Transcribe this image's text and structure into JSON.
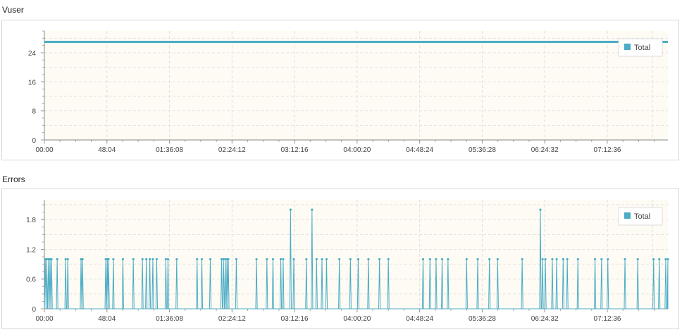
{
  "chart_data": [
    {
      "type": "line",
      "title": "Vuser",
      "xlabel": "",
      "ylabel": "",
      "x_tick_labels": [
        "00:00",
        "48:04",
        "01:36:08",
        "02:24:12",
        "03:12:16",
        "04:00:20",
        "04:48:24",
        "05:36:28",
        "06:24:32",
        "07:12:36"
      ],
      "y_ticks": [
        0,
        8,
        16,
        24
      ],
      "ylim": [
        0,
        30
      ],
      "xlim_seconds": [
        0,
        28750
      ],
      "grid": true,
      "legend": {
        "position": "top-right",
        "entries": [
          "Total"
        ]
      },
      "series": [
        {
          "name": "Total",
          "color": "#4bacc6",
          "x_seconds": [
            0,
            28750
          ],
          "values": [
            27,
            27
          ]
        }
      ]
    },
    {
      "type": "line",
      "title": "Errors",
      "xlabel": "",
      "ylabel": "",
      "x_tick_labels": [
        "00:00",
        "48:04",
        "01:36:08",
        "02:24:12",
        "03:12:16",
        "04:00:20",
        "04:48:24",
        "05:36:28",
        "06:24:32",
        "07:12:36"
      ],
      "y_ticks": [
        0,
        0.6,
        1.2,
        1.8
      ],
      "ylim": [
        0,
        2.2
      ],
      "xlim_seconds": [
        0,
        28750
      ],
      "grid": true,
      "legend": {
        "position": "top-right",
        "entries": [
          "Total"
        ]
      },
      "series": [
        {
          "name": "Total",
          "color": "#4bacc6",
          "spikes": [
            {
              "t": 40,
              "v": 1
            },
            {
              "t": 110,
              "v": 1
            },
            {
              "t": 190,
              "v": 1
            },
            {
              "t": 260,
              "v": 1
            },
            {
              "t": 330,
              "v": 1
            },
            {
              "t": 590,
              "v": 1
            },
            {
              "t": 980,
              "v": 1
            },
            {
              "t": 1080,
              "v": 1
            },
            {
              "t": 1690,
              "v": 1
            },
            {
              "t": 1760,
              "v": 1
            },
            {
              "t": 2830,
              "v": 1
            },
            {
              "t": 2900,
              "v": 1
            },
            {
              "t": 2960,
              "v": 1
            },
            {
              "t": 3180,
              "v": 1
            },
            {
              "t": 3620,
              "v": 1
            },
            {
              "t": 4100,
              "v": 1
            },
            {
              "t": 4520,
              "v": 1
            },
            {
              "t": 4700,
              "v": 1
            },
            {
              "t": 4860,
              "v": 1
            },
            {
              "t": 5000,
              "v": 1
            },
            {
              "t": 5180,
              "v": 1
            },
            {
              "t": 5600,
              "v": 1
            },
            {
              "t": 5700,
              "v": 1
            },
            {
              "t": 6100,
              "v": 1
            },
            {
              "t": 7040,
              "v": 1
            },
            {
              "t": 7260,
              "v": 1
            },
            {
              "t": 7650,
              "v": 1
            },
            {
              "t": 8170,
              "v": 1
            },
            {
              "t": 8260,
              "v": 1
            },
            {
              "t": 8340,
              "v": 1
            },
            {
              "t": 8420,
              "v": 1
            },
            {
              "t": 8480,
              "v": 1
            },
            {
              "t": 8850,
              "v": 1
            },
            {
              "t": 9780,
              "v": 1
            },
            {
              "t": 10260,
              "v": 1
            },
            {
              "t": 10540,
              "v": 1
            },
            {
              "t": 10900,
              "v": 1
            },
            {
              "t": 11010,
              "v": 1
            },
            {
              "t": 11350,
              "v": 2
            },
            {
              "t": 11500,
              "v": 1
            },
            {
              "t": 12080,
              "v": 1
            },
            {
              "t": 12340,
              "v": 2
            },
            {
              "t": 12550,
              "v": 1
            },
            {
              "t": 12800,
              "v": 1
            },
            {
              "t": 13010,
              "v": 1
            },
            {
              "t": 13600,
              "v": 1
            },
            {
              "t": 14110,
              "v": 1
            },
            {
              "t": 14470,
              "v": 1
            },
            {
              "t": 14940,
              "v": 1
            },
            {
              "t": 15450,
              "v": 1
            },
            {
              "t": 15860,
              "v": 1
            },
            {
              "t": 17460,
              "v": 1
            },
            {
              "t": 17780,
              "v": 1
            },
            {
              "t": 18060,
              "v": 1
            },
            {
              "t": 18340,
              "v": 1
            },
            {
              "t": 18610,
              "v": 1
            },
            {
              "t": 19470,
              "v": 1
            },
            {
              "t": 19980,
              "v": 1
            },
            {
              "t": 20520,
              "v": 1
            },
            {
              "t": 20900,
              "v": 1
            },
            {
              "t": 22030,
              "v": 1
            },
            {
              "t": 22870,
              "v": 2
            },
            {
              "t": 22970,
              "v": 1
            },
            {
              "t": 23100,
              "v": 1
            },
            {
              "t": 23420,
              "v": 1
            },
            {
              "t": 23620,
              "v": 1
            },
            {
              "t": 23920,
              "v": 1
            },
            {
              "t": 24110,
              "v": 1
            },
            {
              "t": 24600,
              "v": 1
            },
            {
              "t": 25390,
              "v": 1
            },
            {
              "t": 25690,
              "v": 1
            },
            {
              "t": 25980,
              "v": 1
            },
            {
              "t": 26770,
              "v": 1
            },
            {
              "t": 27360,
              "v": 1
            },
            {
              "t": 28090,
              "v": 1
            },
            {
              "t": 28350,
              "v": 1
            },
            {
              "t": 28650,
              "v": 1
            },
            {
              "t": 28750,
              "v": 1
            }
          ]
        }
      ]
    }
  ]
}
